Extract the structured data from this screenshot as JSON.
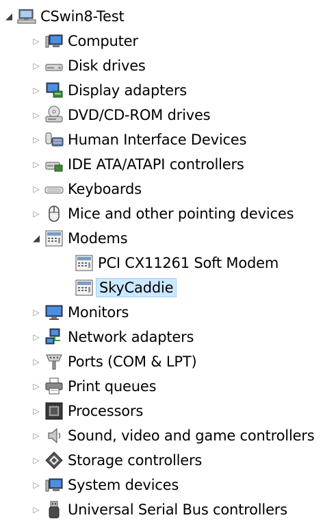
{
  "root": {
    "label": "CSwin8-Test",
    "expanded": true,
    "icon": "computer-network-icon"
  },
  "categories": [
    {
      "label": "Computer",
      "icon": "monitor-icon"
    },
    {
      "label": "Disk drives",
      "icon": "disk-drive-icon"
    },
    {
      "label": "Display adapters",
      "icon": "display-adapter-icon"
    },
    {
      "label": "DVD/CD-ROM drives",
      "icon": "dvd-drive-icon"
    },
    {
      "label": "Human Interface Devices",
      "icon": "hid-icon"
    },
    {
      "label": "IDE ATA/ATAPI controllers",
      "icon": "ide-controller-icon"
    },
    {
      "label": "Keyboards",
      "icon": "keyboard-icon"
    },
    {
      "label": "Mice and other pointing devices",
      "icon": "mouse-icon"
    },
    {
      "label": "Modems",
      "icon": "modem-icon",
      "expanded": true,
      "children": [
        {
          "label": "PCI CX11261 Soft Modem",
          "icon": "modem-icon"
        },
        {
          "label": "SkyCaddie",
          "icon": "modem-icon",
          "selected": true
        }
      ]
    },
    {
      "label": "Monitors",
      "icon": "monitor-icon"
    },
    {
      "label": "Network adapters",
      "icon": "network-adapter-icon"
    },
    {
      "label": "Ports (COM & LPT)",
      "icon": "port-icon"
    },
    {
      "label": "Print queues",
      "icon": "printer-icon"
    },
    {
      "label": "Processors",
      "icon": "processor-icon"
    },
    {
      "label": "Sound, video and game controllers",
      "icon": "speaker-icon"
    },
    {
      "label": "Storage controllers",
      "icon": "storage-controller-icon"
    },
    {
      "label": "System devices",
      "icon": "system-device-icon"
    },
    {
      "label": "Universal Serial Bus controllers",
      "icon": "usb-icon"
    }
  ],
  "colors": {
    "selection_fill": "#cce8ff",
    "selection_border": "#99d1ff",
    "expander": "#8a8a8a"
  }
}
